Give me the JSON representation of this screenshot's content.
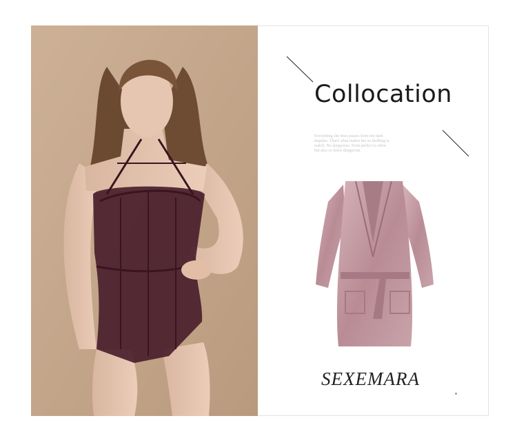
{
  "heading": {
    "title": "Collocation"
  },
  "blurb": {
    "text": "Everything she does passes from the dark impulse. That's what makes her so thrilling to watch. No dangerous. Even perfect is often but also so dolce dangerous."
  },
  "brand": {
    "name": "SEXEMARA"
  },
  "colors": {
    "photo_bg": "#c6a98e",
    "bodysuit": "#4a1f2c",
    "robe": "#c29aa1",
    "title_text": "#1a1a1a"
  }
}
